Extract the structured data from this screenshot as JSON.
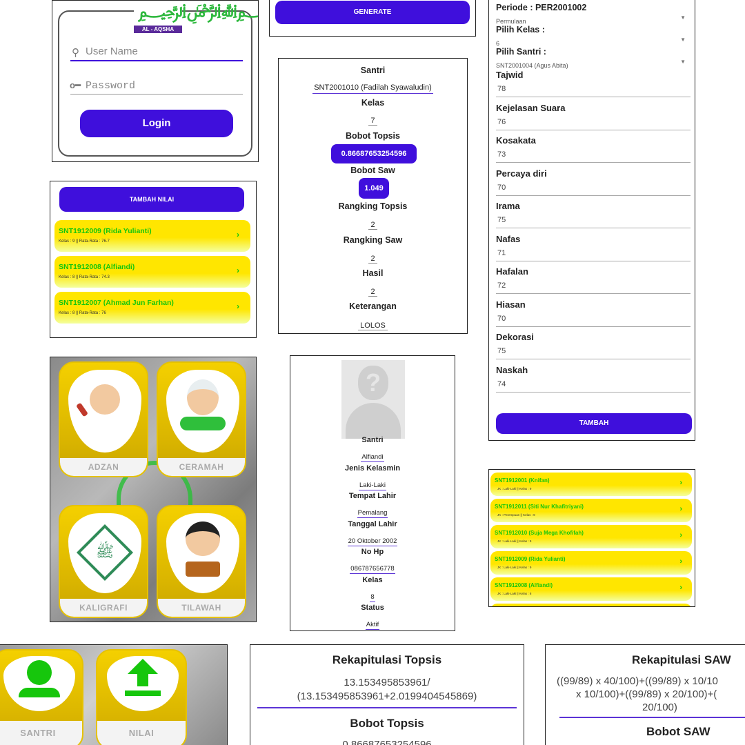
{
  "login": {
    "logo_text": "AL - AQSHA",
    "username_placeholder": "User Name",
    "password_placeholder": "Password",
    "login_label": "Login"
  },
  "generate": {
    "label": "GENERATE"
  },
  "form": {
    "periode": "Periode : PER2001002",
    "periode_value": "Permulaan",
    "kelas_label": "Pilih Kelas :",
    "kelas_value": "6",
    "santri_label": "Pilih Santri :",
    "santri_value": "SNT2001004 (Agus Abita)",
    "fields": [
      {
        "label": "Tajwid",
        "value": "78"
      },
      {
        "label": "Kejelasan Suara",
        "value": "76"
      },
      {
        "label": "Kosakata",
        "value": "73"
      },
      {
        "label": "Percaya diri",
        "value": "70"
      },
      {
        "label": "Irama",
        "value": "75"
      },
      {
        "label": "Nafas",
        "value": "71"
      },
      {
        "label": "Hafalan",
        "value": "72"
      },
      {
        "label": "Hiasan",
        "value": "70"
      },
      {
        "label": "Dekorasi",
        "value": "75"
      },
      {
        "label": "Naskah",
        "value": "74"
      }
    ],
    "tambah_label": "TAMBAH"
  },
  "nilai_list": {
    "button_label": "TAMBAH NILAI",
    "items": [
      {
        "title": "SNT1912009 (Rida Yulianti)",
        "sub": "Kelas : 9 || Rata-Rata : 76.7"
      },
      {
        "title": "SNT1912008 (Alfiandi)",
        "sub": "Kelas : 8 || Rata-Rata : 74.3"
      },
      {
        "title": "SNT1912007 (Ahmad Jun Farhan)",
        "sub": "Kelas : 8 || Rata-Rata : 76"
      }
    ]
  },
  "result": {
    "santri_label": "Santri",
    "santri_value": "SNT2001010 (Fadilah Syawaludin)",
    "kelas_label": "Kelas",
    "kelas_value": "7",
    "topsis_label": "Bobot Topsis",
    "topsis_value": "0.86687653254596",
    "saw_label": "Bobot Saw",
    "saw_value": "1.049",
    "rank_topsis_label": "Rangking Topsis",
    "rank_topsis_value": "2",
    "rank_saw_label": "Rangking Saw",
    "rank_saw_value": "2",
    "hasil_label": "Hasil",
    "hasil_value": "2",
    "ket_label": "Keterangan",
    "ket_value": "LOLOS"
  },
  "categories": {
    "items": [
      "ADZAN",
      "CERAMAH",
      "KALIGRAFI",
      "TILAWAH"
    ]
  },
  "profile": {
    "fields": [
      {
        "label": "Santri",
        "value": "Alfiandi"
      },
      {
        "label": "Jenis Kelasmin",
        "value": "Laki-Laki"
      },
      {
        "label": "Tempat Lahir",
        "value": "Pemalang"
      },
      {
        "label": "Tanggal Lahir",
        "value": "20 Oktober 2002"
      },
      {
        "label": "No Hp",
        "value": "086787656778"
      },
      {
        "label": "Kelas",
        "value": "8"
      },
      {
        "label": "Status",
        "value": "Aktif"
      }
    ]
  },
  "santri_list": {
    "items": [
      {
        "title": "SNT1912001 (Knifan)",
        "sub": "JK : Laki-Laki || Kelas : 9"
      },
      {
        "title": "SNT1912011 (Siti Nur Khafitriyani)",
        "sub": "JK : Perempuan || Kelas : 9"
      },
      {
        "title": "SNT1912010 (Suja Mega Khofifah)",
        "sub": "JK : Laki-Laki || Kelas : 9"
      },
      {
        "title": "SNT1912009 (Rida Yulianti)",
        "sub": "JK : Laki-Laki || Kelas : 9"
      },
      {
        "title": "SNT1912008 (Alfiandi)",
        "sub": "JK : Laki-Laki || Kelas : 8"
      }
    ]
  },
  "menu": {
    "santri_label": "SANTRI",
    "nilai_label": "NILAI"
  },
  "rekap_topsis": {
    "title": "Rekapitulasi Topsis",
    "formula_1": "13.153495853961/",
    "formula_2": "(13.153495853961+2.0199404545869)",
    "bobot_label": "Bobot Topsis",
    "bobot_value": "0.86687653254596"
  },
  "rekap_saw": {
    "title": "Rekapitulasi SAW",
    "formula_1": "((99/89) x 40/100)+((99/89) x 10/10",
    "formula_2": "x 10/100)+((99/89) x 20/100)+(",
    "formula_3": "20/100)",
    "bobot_label": "Bobot SAW"
  },
  "colors": {
    "purple": "#3f0fdc",
    "yellow": "#ffe600",
    "green": "#16c60c"
  }
}
